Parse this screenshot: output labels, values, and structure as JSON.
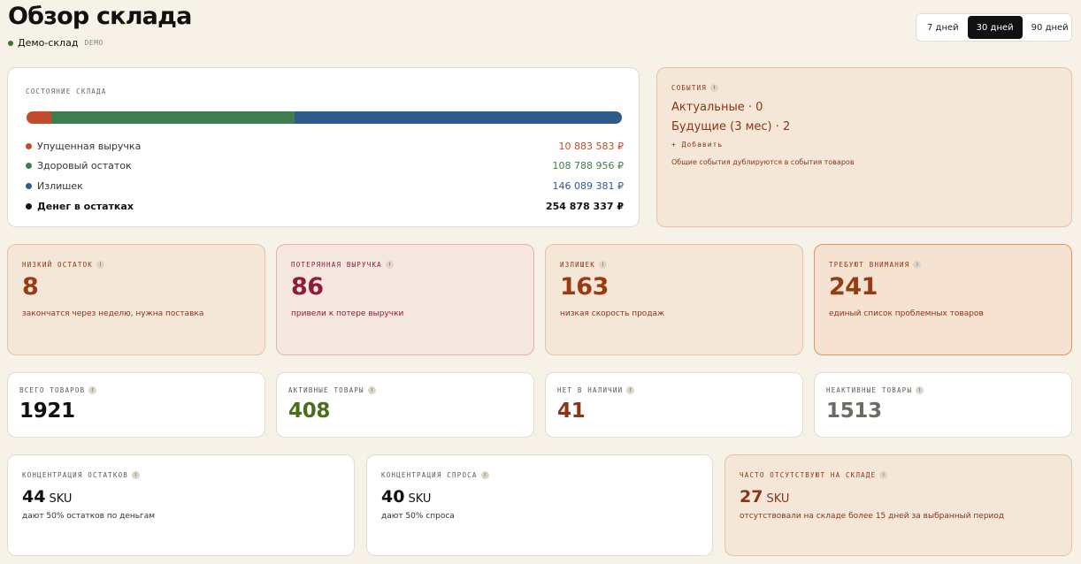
{
  "header": {
    "title": "Обзор склада",
    "store_name": "Демо-склад",
    "store_badge": "DEMO",
    "periods": [
      "7 дней",
      "30 дней",
      "90 дней"
    ],
    "active_period": "30 дней"
  },
  "stock_status": {
    "title": "Состояние склада",
    "segments": [
      {
        "label": "Упущенная выручка",
        "value": "10 883 583 ₽",
        "amount": 10883583,
        "color": "#c44a2c"
      },
      {
        "label": "Здоровый остаток",
        "value": "108 788 956 ₽",
        "amount": 108788956,
        "color": "#3e7d4c"
      },
      {
        "label": "Излишек",
        "value": "146 089 381 ₽",
        "amount": 146089381,
        "color": "#2f5b8a"
      }
    ],
    "total": {
      "label": "Денег в остатках",
      "value": "254 878 337 ₽",
      "color": "#111111"
    }
  },
  "events": {
    "title": "События",
    "current": "Актуальные · 0",
    "future": "Будущие (3 мес) · 2",
    "add_label": "+ Добавить",
    "note": "Общие события дублируются в события товаров"
  },
  "kpis": [
    {
      "title": "Низкий остаток",
      "value": "8",
      "subtitle": "закончатся через неделю, нужна поставка"
    },
    {
      "title": "Потерянная выручка",
      "value": "86",
      "subtitle": "привели к потере выручки"
    },
    {
      "title": "Излишек",
      "value": "163",
      "subtitle": "низкая скорость продаж"
    },
    {
      "title": "Требуют внимания",
      "value": "241",
      "subtitle": "единый список проблемных товаров"
    }
  ],
  "counts": [
    {
      "title": "Всего товаров",
      "value": "1921"
    },
    {
      "title": "Активные товары",
      "value": "408"
    },
    {
      "title": "Нет в наличии",
      "value": "41"
    },
    {
      "title": "Неактивные товары",
      "value": "1513"
    }
  ],
  "concentration": [
    {
      "title": "Концентрация остатков",
      "value": "44",
      "unit": "SKU",
      "subtitle": "дают 50% остатков по деньгам"
    },
    {
      "title": "Концентрация спроса",
      "value": "40",
      "unit": "SKU",
      "subtitle": "дают 50% спроса"
    },
    {
      "title": "Часто отсутствуют на складе",
      "value": "27",
      "unit": "SKU",
      "subtitle": "отсутствовали на складе более 15 дней за выбранный период"
    }
  ],
  "info_icon_glyph": "i"
}
